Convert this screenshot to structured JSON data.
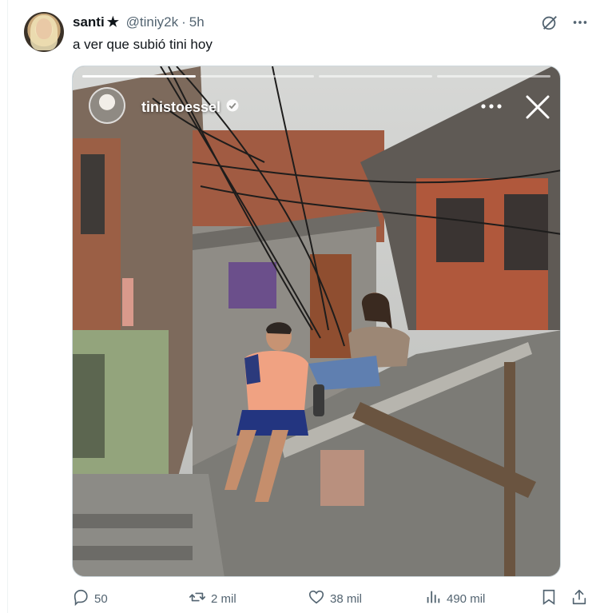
{
  "post": {
    "display_name": "santi",
    "star": "★",
    "handle": "@tiniy2k",
    "separator": "·",
    "time": "5h",
    "text": "a ver que subió tini hoy"
  },
  "header_icons": [
    "grok-icon",
    "more-icon"
  ],
  "media": {
    "story_username": "tinistoessel",
    "verified": true,
    "bar_count": 4,
    "active_bar": 0
  },
  "actions": {
    "replies": "50",
    "reposts": "2 mil",
    "likes": "38 mil",
    "views": "490 mil"
  },
  "colors": {
    "text_primary": "#0f1419",
    "text_secondary": "#536471",
    "border": "#cfd9de"
  }
}
